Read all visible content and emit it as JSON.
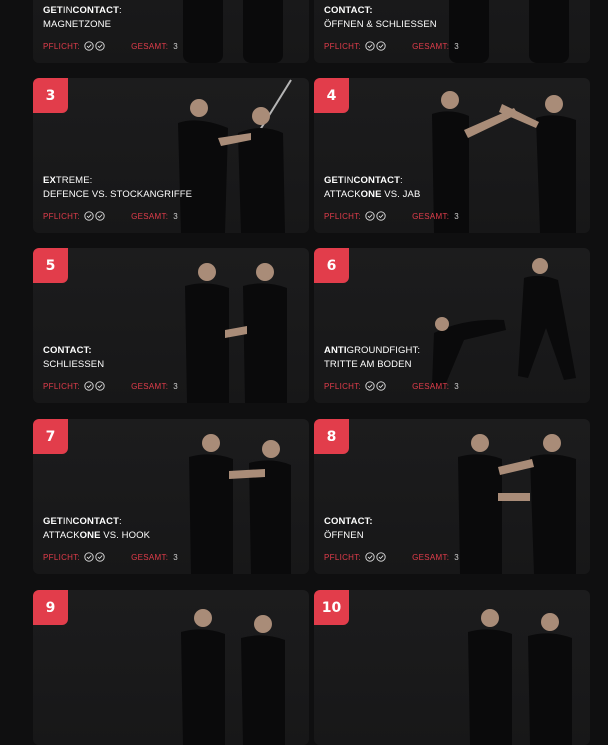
{
  "labels": {
    "pflicht": "PFLICHT:",
    "gesamt": "GESAMT:"
  },
  "accent_color": "#e23d4b",
  "cards": [
    {
      "number": "",
      "title_line1_parts": [
        "GET",
        "IN",
        "CONTACT",
        ":"
      ],
      "title_line2": "MAGNETZONE",
      "gesamt_value": "3",
      "pflicht_icons": [
        "check-circle-icon",
        "check-circle-icon"
      ]
    },
    {
      "number": "",
      "title_line1_parts": [
        "CONTACT:",
        "",
        "",
        ""
      ],
      "title_line2": "ÖFFNEN & SCHLIESSEN",
      "gesamt_value": "3",
      "pflicht_icons": [
        "check-circle-icon",
        "check-circle-icon"
      ]
    },
    {
      "number": "3",
      "title_line1_parts": [
        "E",
        "X",
        "TREME:",
        ""
      ],
      "title_line2": "DEFENCE VS. STOCKANGRIFFE",
      "gesamt_value": "3",
      "pflicht_icons": [
        "check-circle-icon",
        "check-circle-icon"
      ]
    },
    {
      "number": "4",
      "title_line1_parts": [
        "GET",
        "IN",
        "CONTACT",
        ":"
      ],
      "title_line2_parts": [
        "ATTACK",
        "ONE",
        " VS. JAB"
      ],
      "gesamt_value": "3",
      "pflicht_icons": [
        "check-circle-icon",
        "check-circle-icon"
      ]
    },
    {
      "number": "5",
      "title_line1_parts": [
        "CONTACT:",
        "",
        "",
        ""
      ],
      "title_line2": "SCHLIESSEN",
      "gesamt_value": "3",
      "pflicht_icons": [
        "check-circle-icon",
        "check-circle-icon"
      ]
    },
    {
      "number": "6",
      "title_line1_parts": [
        "ANTI",
        "GROUNDFIGHT:",
        "",
        ""
      ],
      "title_line2": "TRITTE AM BODEN",
      "gesamt_value": "3",
      "pflicht_icons": [
        "check-circle-icon",
        "check-circle-icon"
      ]
    },
    {
      "number": "7",
      "title_line1_parts": [
        "GET",
        "IN",
        "CONTACT",
        ":"
      ],
      "title_line2_parts": [
        "ATTACK",
        "ONE",
        " VS. HOOK"
      ],
      "gesamt_value": "3",
      "pflicht_icons": [
        "check-circle-icon",
        "check-circle-icon"
      ]
    },
    {
      "number": "8",
      "title_line1_parts": [
        "CONTACT:",
        "",
        "",
        ""
      ],
      "title_line2": "ÖFFNEN",
      "gesamt_value": "3",
      "pflicht_icons": [
        "check-circle-icon",
        "check-circle-icon"
      ]
    },
    {
      "number": "9"
    },
    {
      "number": "10"
    }
  ]
}
